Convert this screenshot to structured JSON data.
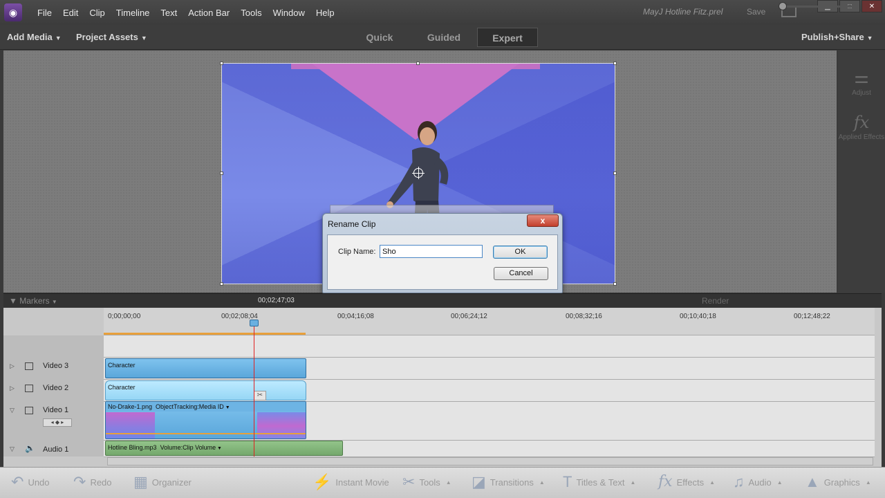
{
  "menubar": {
    "items": [
      "File",
      "Edit",
      "Clip",
      "Timeline",
      "Text",
      "Action Bar",
      "Tools",
      "Window",
      "Help"
    ],
    "document_title": "MayJ Hotline Fitz.prel",
    "save_label": "Save"
  },
  "modebar": {
    "add_media": "Add Media",
    "project_assets": "Project Assets",
    "tabs": [
      "Quick",
      "Guided",
      "Expert"
    ],
    "active_tab": "Expert",
    "publish_share": "Publish+Share"
  },
  "right_panel": {
    "adjust": "Adjust",
    "applied_effects": "Applied Effects"
  },
  "dialog": {
    "title": "Rename Clip",
    "close_label": "x",
    "field_label": "Clip Name:",
    "field_value": "Sho",
    "ok_label": "OK",
    "cancel_label": "Cancel"
  },
  "timeline_header": {
    "markers_label": "Markers",
    "current_time": "00;02;47;03",
    "render_label": "Render"
  },
  "ruler": {
    "labels": [
      "0;00;00;00",
      "00;02;08;04",
      "00;04;16;08",
      "00;06;24;12",
      "00;08;32;16",
      "00;10;40;18",
      "00;12;48;22"
    ]
  },
  "tracks": [
    {
      "name": "Video 3",
      "clip": "Character"
    },
    {
      "name": "Video 2",
      "clip": "Character"
    },
    {
      "name": "Video 1",
      "clip": "No-Drake-1.png",
      "effect": "ObjectTracking:Media ID"
    },
    {
      "name": "Audio 1",
      "clip": "Hotline Bling.mp3",
      "effect": "Volume:Clip Volume"
    }
  ],
  "actionbar": {
    "undo": "Undo",
    "redo": "Redo",
    "organizer": "Organizer",
    "instant_movie": "Instant Movie",
    "tools": "Tools",
    "transitions": "Transitions",
    "titles_text": "Titles & Text",
    "effects": "Effects",
    "audio": "Audio",
    "graphics": "Graphics"
  }
}
